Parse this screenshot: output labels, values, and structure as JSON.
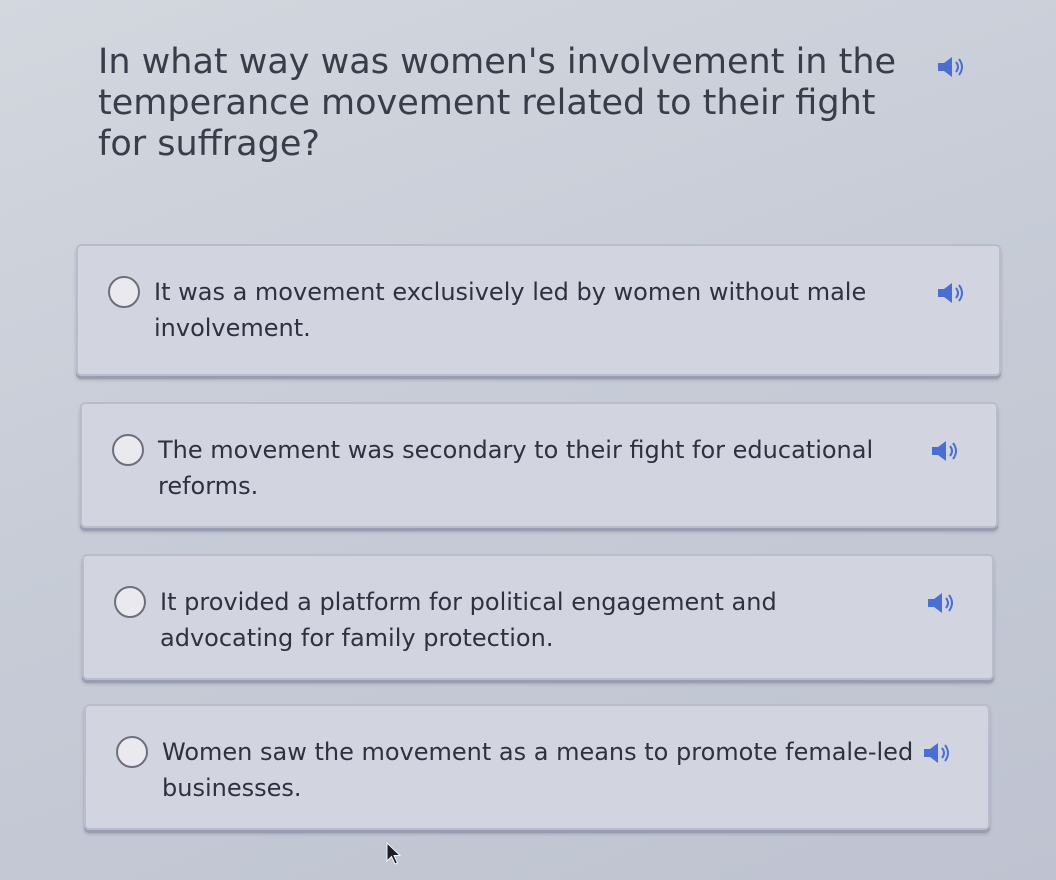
{
  "question": {
    "text": "In what way was women's involvement in the temperance movement related to their fight for suffrage?",
    "speaker_icon": "speaker-icon"
  },
  "options": [
    {
      "label": "It was a movement exclusively led by women without male involvement.",
      "selected": false,
      "speaker_icon": "speaker-icon"
    },
    {
      "label": "The movement was secondary to their fight for educational reforms.",
      "selected": false,
      "speaker_icon": "speaker-icon"
    },
    {
      "label": "It provided a platform for political engagement and advocating for family protection.",
      "selected": false,
      "speaker_icon": "speaker-icon"
    },
    {
      "label": "Women saw the movement as a means to promote female-led businesses.",
      "selected": false,
      "speaker_icon": "speaker-icon"
    }
  ],
  "colors": {
    "accent": "#4a6fd1",
    "option_background": "#d2d4e0",
    "text": "#2f3140"
  }
}
